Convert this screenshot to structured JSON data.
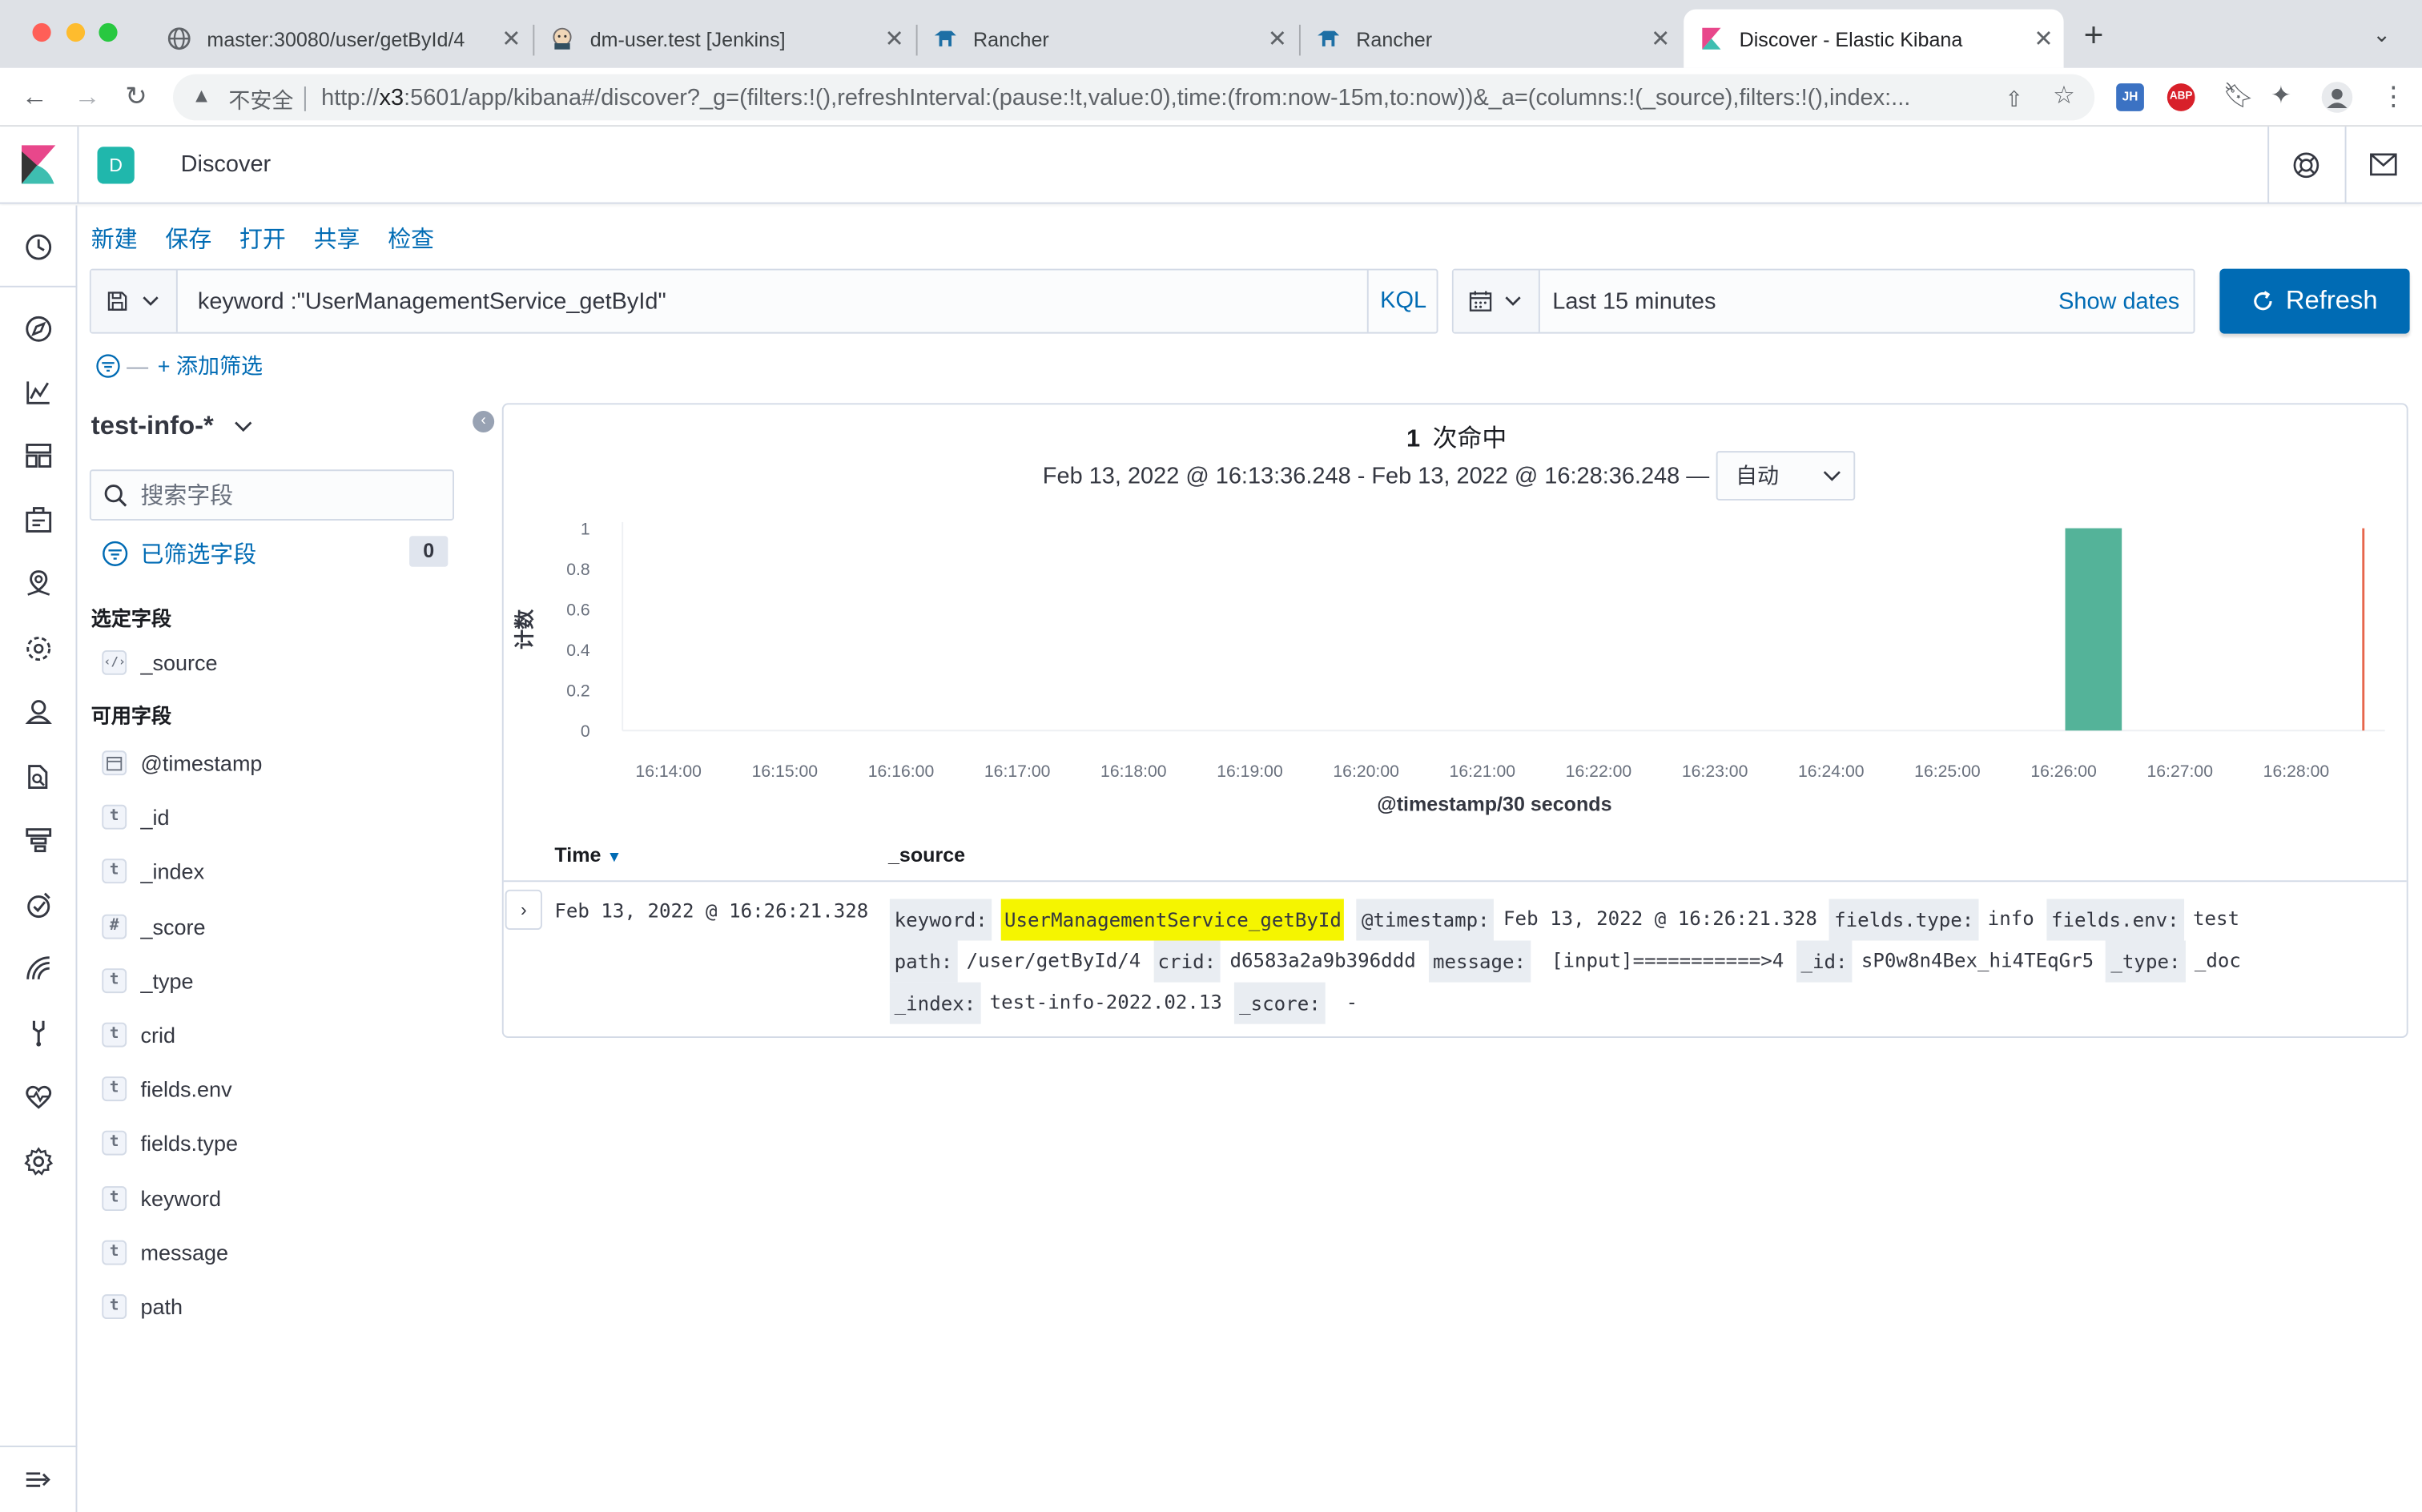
{
  "browser": {
    "tabs": [
      {
        "title": "master:30080/user/getById/4",
        "icon": "globe-icon"
      },
      {
        "title": "dm-user.test [Jenkins]",
        "icon": "jenkins-icon"
      },
      {
        "title": "Rancher",
        "icon": "rancher-icon"
      },
      {
        "title": "Rancher",
        "icon": "rancher-icon"
      },
      {
        "title": "Discover - Elastic Kibana",
        "icon": "kibana-icon",
        "active": true
      }
    ],
    "address": {
      "insecure_label": "不安全",
      "url_prefix": "http://",
      "url_host": "x3",
      "url_rest": ":5601/app/kibana#/discover?_g=(filters:!(),refreshInterval:(pause:!t,value:0),time:(from:now-15m,to:now))&_a=(columns:!(_source),filters:!(),index:..."
    },
    "extensions": [
      "JH",
      "ABP"
    ]
  },
  "kibana": {
    "space_initial": "D",
    "breadcrumb": "Discover",
    "top_menu": [
      "新建",
      "保存",
      "打开",
      "共享",
      "检查"
    ],
    "query": "keyword :\"UserManagementService_getById\"",
    "language": "KQL",
    "time_range": "Last 15 minutes",
    "show_dates": "Show dates",
    "refresh": "Refresh",
    "add_filter": "+ 添加筛选",
    "index_pattern": "test-info-*",
    "field_search_placeholder": "搜索字段",
    "filtered_fields_label": "已筛选字段",
    "filtered_fields_count": "0",
    "selected_fields_title": "选定字段",
    "selected_fields": [
      {
        "name": "_source",
        "type": "source"
      }
    ],
    "available_fields_title": "可用字段",
    "available_fields": [
      {
        "name": "@timestamp",
        "type": "date"
      },
      {
        "name": "_id",
        "type": "t"
      },
      {
        "name": "_index",
        "type": "t"
      },
      {
        "name": "_score",
        "type": "#"
      },
      {
        "name": "_type",
        "type": "t"
      },
      {
        "name": "crid",
        "type": "t"
      },
      {
        "name": "fields.env",
        "type": "t"
      },
      {
        "name": "fields.type",
        "type": "t"
      },
      {
        "name": "keyword",
        "type": "t"
      },
      {
        "name": "message",
        "type": "t"
      },
      {
        "name": "path",
        "type": "t"
      }
    ],
    "hits_count": "1",
    "hits_label": "次命中",
    "range_text": "Feb 13, 2022 @ 16:13:36.248 - Feb 13, 2022 @ 16:28:36.248 —",
    "interval": "自动",
    "table": {
      "col_time": "Time",
      "col_source": "_source",
      "rows": [
        {
          "time": "Feb 13, 2022 @ 16:26:21.328",
          "source_lines": [
            [
              {
                "k": "keyword:",
                "v": "UserManagementService_getById",
                "hl": true
              },
              {
                "k": "@timestamp:",
                "v": "Feb 13, 2022 @ 16:26:21.328"
              },
              {
                "k": "fields.type:",
                "v": "info"
              },
              {
                "k": "fields.env:",
                "v": "test"
              }
            ],
            [
              {
                "k": "path:",
                "v": "/user/getById/4"
              },
              {
                "k": "crid:",
                "v": "d6583a2a9b396ddd"
              },
              {
                "k": "message:",
                "v": " [input]===========>4"
              },
              {
                "k": "_id:",
                "v": "sP0w8n4Bex_hi4TEqGr5"
              },
              {
                "k": "_type:",
                "v": "_doc"
              }
            ],
            [
              {
                "k": "_index:",
                "v": "test-info-2022.02.13"
              },
              {
                "k": "_score:",
                "v": " -"
              }
            ]
          ]
        }
      ]
    }
  },
  "chart_data": {
    "type": "bar",
    "xlabel": "@timestamp/30 seconds",
    "ylabel": "计数",
    "ylim": [
      0,
      1
    ],
    "yticks": [
      "0",
      "0.2",
      "0.4",
      "0.6",
      "0.8",
      "1"
    ],
    "xticks": [
      "16:14:00",
      "16:15:00",
      "16:16:00",
      "16:17:00",
      "16:18:00",
      "16:19:00",
      "16:20:00",
      "16:21:00",
      "16:22:00",
      "16:23:00",
      "16:24:00",
      "16:25:00",
      "16:26:00",
      "16:27:00",
      "16:28:00"
    ],
    "x_range": [
      "16:13:36.248",
      "16:28:36.248"
    ],
    "bars": [
      {
        "x": "16:26:00",
        "value": 1
      }
    ],
    "now_marker": "16:28:36.248",
    "bar_color": "#54b399",
    "marker_color": "#e7664c",
    "grid": false
  }
}
